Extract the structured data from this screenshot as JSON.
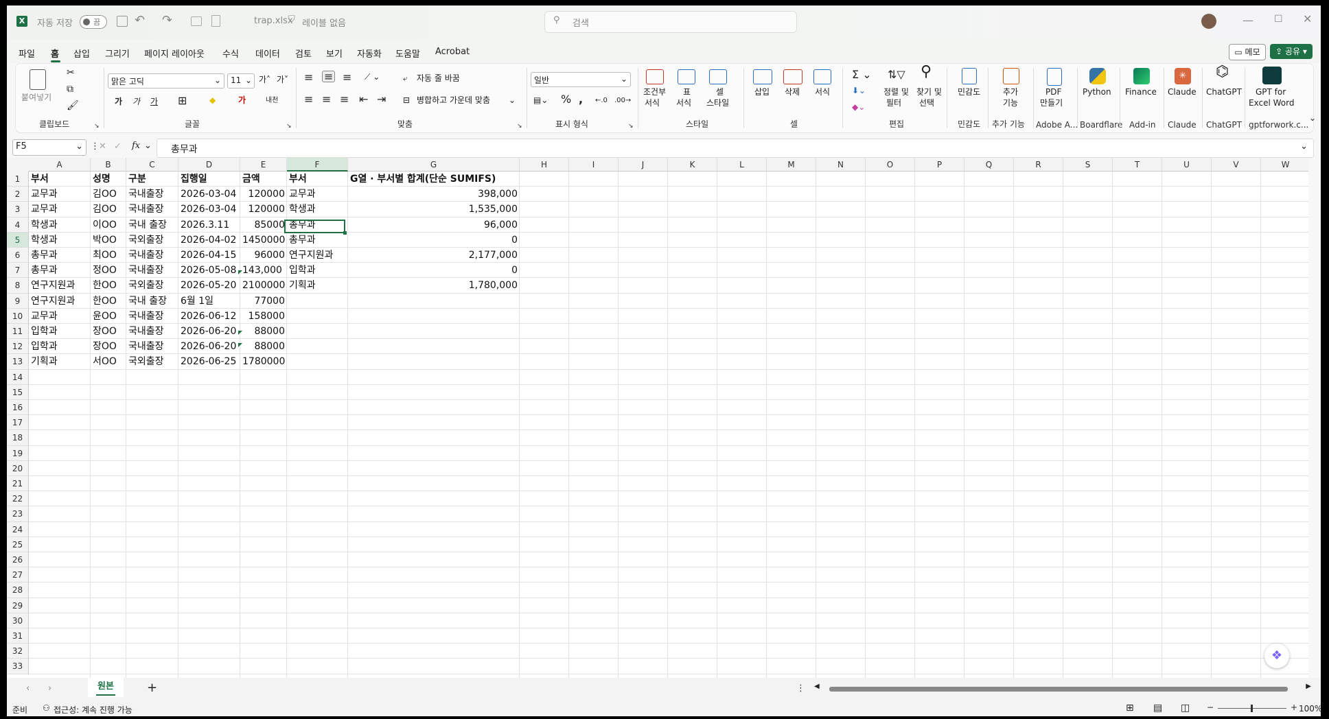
{
  "titlebar": {
    "autosave_label": "자동 저장",
    "autosave_state": "끔",
    "filename": "trap.xlsx",
    "label_status": "레이블 없음",
    "search_placeholder": "검색"
  },
  "menu_tabs": [
    "파일",
    "홈",
    "삽입",
    "그리기",
    "페이지 레이아웃",
    "수식",
    "데이터",
    "검토",
    "보기",
    "자동화",
    "도움말",
    "Acrobat"
  ],
  "active_tab": "홈",
  "memo_button": "메모",
  "share_button": "공유",
  "ribbon": {
    "paste": "붙여넣기",
    "font_name": "맑은 고딕",
    "font_size": "11",
    "bold": "가",
    "italic": "가",
    "underline": "가",
    "phonetic": "내천",
    "wrap_text": "자동 줄 바꿈",
    "merge_center": "병합하고 가운데 맞춤",
    "number_format": "일반",
    "cond_format": [
      "조건부",
      "서식"
    ],
    "format_table": [
      "표",
      "서식"
    ],
    "cell_style": [
      "셀",
      "스타일"
    ],
    "insert": "삽입",
    "delete": "삭제",
    "format": "서식",
    "sort_filter": [
      "정렬 및",
      "필터"
    ],
    "find_select": [
      "찾기 및",
      "선택"
    ],
    "sensitivity": "민감도",
    "addins": [
      "추가",
      "기능"
    ],
    "pdf": [
      "PDF",
      "만들기"
    ],
    "python": "Python",
    "finance": "Finance",
    "claude": "Claude",
    "chatgpt": "ChatGPT",
    "gpt_word": [
      "GPT for",
      "Excel Word"
    ],
    "groups": {
      "clipboard": "클립보드",
      "font": "글꼴",
      "alignment": "맞춤",
      "number": "표시 형식",
      "styles": "스타일",
      "cells": "셀",
      "editing": "편집",
      "sensitivity": "민감도",
      "addins": "추가 기능",
      "adobe": "Adobe A...",
      "boardflare": "Boardflare",
      "addin": "Add-in",
      "claude": "Claude",
      "chatgpt": "ChatGPT",
      "gptforwork": "gptforwork.c..."
    }
  },
  "formula_bar": {
    "name_box": "F5",
    "fx": "fx",
    "content": "총무과"
  },
  "columns": [
    "A",
    "B",
    "C",
    "D",
    "E",
    "F",
    "G",
    "H",
    "I",
    "J",
    "K",
    "L",
    "M",
    "N",
    "O",
    "P",
    "Q",
    "R",
    "S",
    "T",
    "U",
    "V",
    "W"
  ],
  "rows": [
    {
      "A": "부서",
      "B": "성명",
      "C": "구분",
      "D": "집행일",
      "E": "금액",
      "F": "부서",
      "G": "G열 · 부서별 합계(단순 SUMIFS)"
    },
    {
      "A": "교무과",
      "B": "김OO",
      "C": "국내출장",
      "D": "2026-03-04",
      "E": "120000",
      "F": "교무과",
      "G": "398,000"
    },
    {
      "A": "교무과",
      "B": "김OO",
      "C": "국내출장",
      "D": "2026-03-04",
      "E": "120000",
      "F": "학생과",
      "G": "1,535,000"
    },
    {
      "A": "학생과",
      "B": "이OO",
      "C": "국내 출장",
      "D": "2026.3.11",
      "E": "85000",
      "F": "총무과",
      "G": "96,000"
    },
    {
      "A": "학생과",
      "B": "박OO",
      "C": "국외출장",
      "D": "2026-04-02",
      "E": "1450000",
      "F": "총무과",
      "G": "0"
    },
    {
      "A": "총무과",
      "B": "최OO",
      "C": "국내출장",
      "D": "2026-04-15",
      "E": "96000",
      "F": "연구지원과",
      "G": "2,177,000"
    },
    {
      "A": "총무과",
      "B": "정OO",
      "C": "국내출장",
      "D": "2026-05-08",
      "E": "143,000",
      "F": "입학과",
      "G": "0"
    },
    {
      "A": "연구지원과",
      "B": "한OO",
      "C": "국외출장",
      "D": "2026-05-20",
      "E": "2100000",
      "F": "기획과",
      "G": "1,780,000"
    },
    {
      "A": "연구지원과",
      "B": "한OO",
      "C": "국내 출장",
      "D": "6월 1일",
      "E": "77000",
      "F": "",
      "G": ""
    },
    {
      "A": "교무과",
      "B": "윤OO",
      "C": "국내출장",
      "D": "2026-06-12",
      "E": "158000",
      "F": "",
      "G": ""
    },
    {
      "A": "입학과",
      "B": "장OO",
      "C": "국내출장",
      "D": "2026-06-20",
      "E": "88000",
      "F": "",
      "G": ""
    },
    {
      "A": "입학과",
      "B": "장OO",
      "C": "국내출장",
      "D": "2026-06-20",
      "E": "88000",
      "F": "",
      "G": ""
    },
    {
      "A": "기획과",
      "B": "서OO",
      "C": "국외출장",
      "D": "2026-06-25",
      "E": "1780000",
      "F": "",
      "G": ""
    }
  ],
  "row_count": 33,
  "sheet_tabs": [
    "원본"
  ],
  "status": {
    "ready": "준비",
    "accessibility": "접근성: 계속 진행 가능",
    "zoom": "100%"
  }
}
